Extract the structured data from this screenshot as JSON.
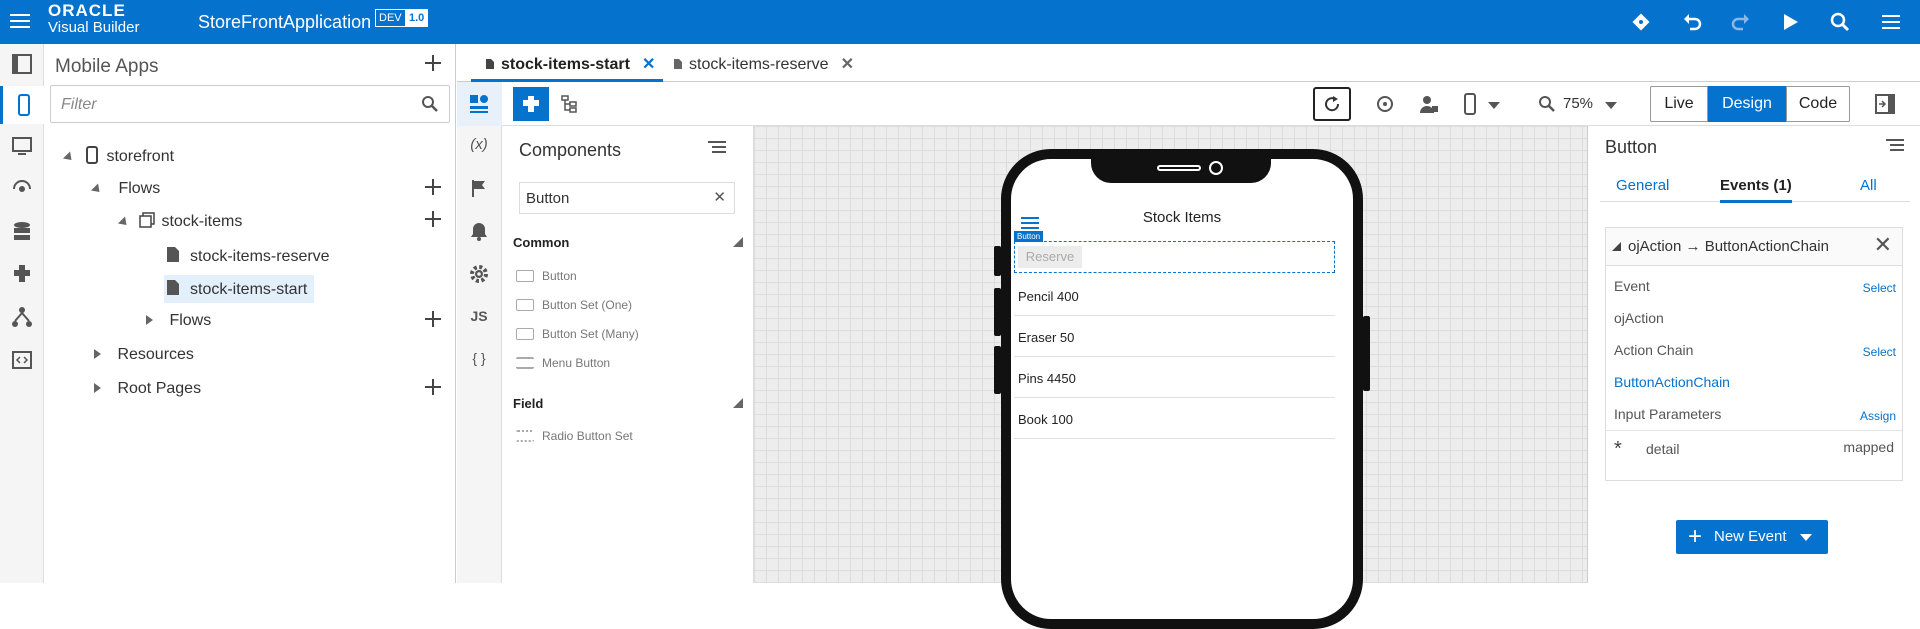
{
  "topbar": {
    "logo_line1": "ORACLE",
    "logo_line2": "Visual Builder",
    "app_name": "StoreFrontApplication",
    "badge_dev": "DEV",
    "badge_version": "1.0"
  },
  "nav": {
    "header": "Mobile Apps",
    "filter_placeholder": "Filter",
    "tree": {
      "root": "storefront",
      "flows": "Flows",
      "stock_items": "stock-items",
      "reserve": "stock-items-reserve",
      "start": "stock-items-start",
      "sub_flows": "Flows",
      "resources": "Resources",
      "root_pages": "Root Pages"
    }
  },
  "tabs": [
    {
      "label": "stock-items-start"
    },
    {
      "label": "stock-items-reserve"
    }
  ],
  "toolbar": {
    "zoom": "75%",
    "live": "Live",
    "design": "Design",
    "code": "Code"
  },
  "sidebar_icons": {
    "variables": "(x)",
    "js": "JS",
    "json": "{ }"
  },
  "palette": {
    "title": "Components",
    "search": "Button",
    "section_common": "Common",
    "common_items": [
      "Button",
      "Button Set (One)",
      "Button Set (Many)",
      "Menu Button"
    ],
    "section_field": "Field",
    "field_items": [
      "Radio Button Set"
    ]
  },
  "phone": {
    "screen_title": "Stock Items",
    "button_tag": "Button",
    "reserve_label": "Reserve",
    "rows": [
      "Pencil  400",
      "Eraser  50",
      "Pins  4450",
      "Book  100"
    ]
  },
  "props": {
    "title": "Button",
    "tabs": {
      "general": "General",
      "events": "Events (1)",
      "all": "All"
    },
    "event_header": "ojAction → ButtonActionChain",
    "event_label": "Event",
    "event_select": "Select",
    "event_value": "ojAction",
    "chain_label": "Action Chain",
    "chain_select": "Select",
    "chain_value": "ButtonActionChain",
    "params_label": "Input Parameters",
    "params_assign": "Assign",
    "param_name": "detail",
    "param_status": "mapped",
    "new_event": "New Event"
  },
  "colors": {
    "brand": "#0572ce"
  }
}
